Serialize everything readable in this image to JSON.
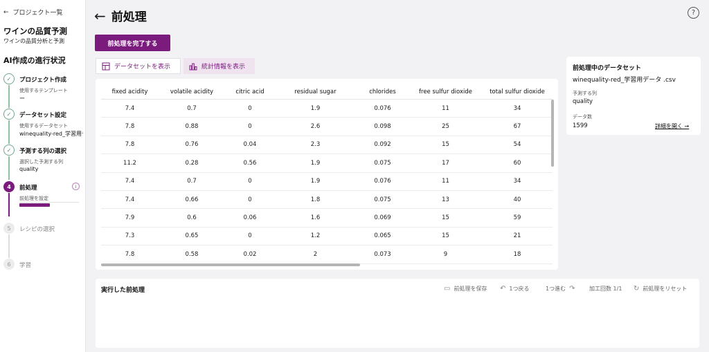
{
  "sidebar": {
    "back_label": "プロジェクト一覧",
    "project_title": "ワインの品質予測",
    "project_subtitle": "ワインの品質分析と予測",
    "progress_title": "AI作成の進行状況",
    "steps": [
      {
        "label": "プロジェクト作成",
        "sub": "使用するテンプレート",
        "value": "ー",
        "state": "done"
      },
      {
        "label": "データセット設定",
        "sub": "使用するデータセット",
        "value": "winequality-red_学習用データ.csv",
        "state": "done"
      },
      {
        "label": "予測する列の選択",
        "sub": "選択した予測する列",
        "value": "quality",
        "state": "done"
      },
      {
        "label": "前処理",
        "number": "4",
        "sub": "前処理を設定",
        "state": "active"
      },
      {
        "label": "レシピの選択",
        "number": "5",
        "state": "todo"
      },
      {
        "label": "学習",
        "number": "6",
        "state": "todo"
      }
    ]
  },
  "header": {
    "title": "前処理",
    "finish_button": "前処理を完了する"
  },
  "tabs": [
    {
      "label": "データセットを表示"
    },
    {
      "label": "統計情報を表示"
    }
  ],
  "table": {
    "columns": [
      "fixed acidity",
      "volatile acidity",
      "citric acid",
      "residual sugar",
      "chlorides",
      "free sulfur dioxide",
      "total sulfur dioxide"
    ],
    "rows": [
      [
        "7.4",
        "0.7",
        "0",
        "1.9",
        "0.076",
        "11",
        "34"
      ],
      [
        "7.8",
        "0.88",
        "0",
        "2.6",
        "0.098",
        "25",
        "67"
      ],
      [
        "7.8",
        "0.76",
        "0.04",
        "2.3",
        "0.092",
        "15",
        "54"
      ],
      [
        "11.2",
        "0.28",
        "0.56",
        "1.9",
        "0.075",
        "17",
        "60"
      ],
      [
        "7.4",
        "0.7",
        "0",
        "1.9",
        "0.076",
        "11",
        "34"
      ],
      [
        "7.4",
        "0.66",
        "0",
        "1.8",
        "0.075",
        "13",
        "40"
      ],
      [
        "7.9",
        "0.6",
        "0.06",
        "1.6",
        "0.069",
        "15",
        "59"
      ],
      [
        "7.3",
        "0.65",
        "0",
        "1.2",
        "0.065",
        "15",
        "21"
      ],
      [
        "7.8",
        "0.58",
        "0.02",
        "2",
        "0.073",
        "9",
        "18"
      ]
    ]
  },
  "dataset_card": {
    "heading": "前処理中のデータセット",
    "file_name": "winequality-red_学習用データ .csv",
    "target_label": "予測する列",
    "target_value": "quality",
    "count_label": "データ数",
    "count_value": "1599",
    "details_link": "詳細を開く"
  },
  "history": {
    "title": "実行した前処理",
    "save": "前処理を保存",
    "undo": "1つ戻る",
    "redo": "1つ進む",
    "count": "加工回数 1/1",
    "reset": "前処理をリセット"
  },
  "colors": {
    "accent": "#7b1b7e",
    "done": "#6ca78a"
  }
}
